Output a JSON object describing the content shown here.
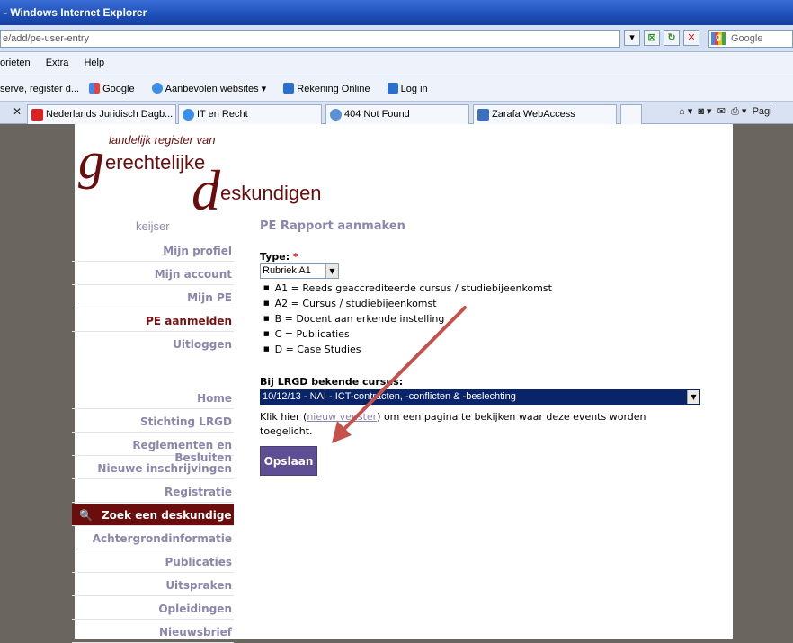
{
  "browser": {
    "title": "- Windows Internet Explorer",
    "url": "e/add/pe-user-entry",
    "search_provider": "Google",
    "menu": [
      "orieten",
      "Extra",
      "Help"
    ],
    "favorites": [
      "serve, register d...",
      "Google",
      "Aanbevolen websites ▾",
      "Rekening Online",
      "Log in"
    ],
    "tabs": [
      "Nederlands Juridisch Dagb...",
      "IT en Recht",
      "404 Not Found",
      "Zarafa WebAccess"
    ],
    "tools_label": "Pagi"
  },
  "logo": {
    "line1": "landelijk register van",
    "g": "g",
    "line2": "erechtelijke",
    "d": "d",
    "line3": "eskundigen"
  },
  "sidebar": {
    "username": "keijser",
    "user_items": [
      "Mijn profiel",
      "Mijn account",
      "Mijn PE",
      "PE aanmelden",
      "Uitloggen"
    ],
    "main_items": [
      "Home",
      "Stichting LRGD",
      "Reglementen en Besluiten",
      "Nieuwe inschrijvingen",
      "Registratie",
      "Zoek een deskundige",
      "Achtergrondinformatie",
      "Publicaties",
      "Uitspraken",
      "Opleidingen",
      "Nieuwsbrief"
    ]
  },
  "form": {
    "title": "PE Rapport aanmaken",
    "type_label": "Type:",
    "required_mark": "*",
    "type_value": "Rubriek A1",
    "type_options": [
      "A1 = Reeds geaccrediteerde cursus / studiebijeenkomst",
      "A2 = Cursus / studiebijeenkomst",
      "B = Docent aan erkende instelling",
      "C = Publicaties",
      "D = Case Studies"
    ],
    "course_label": "Bij LRGD bekende cursus:",
    "course_value": "10/12/13 - NAI - ICT-contracten, -conflicten & -beslechting",
    "note_before": "Klik hier (",
    "note_link": "nieuw venster",
    "note_after": ") om een pagina te bekijken waar deze events worden toegelicht.",
    "save_label": "Opslaan"
  },
  "colors": {
    "brand": "#6b0d0d",
    "nav": "#8c86ac",
    "button": "#5e4f94",
    "annotation_arrow": "#c4524a"
  }
}
